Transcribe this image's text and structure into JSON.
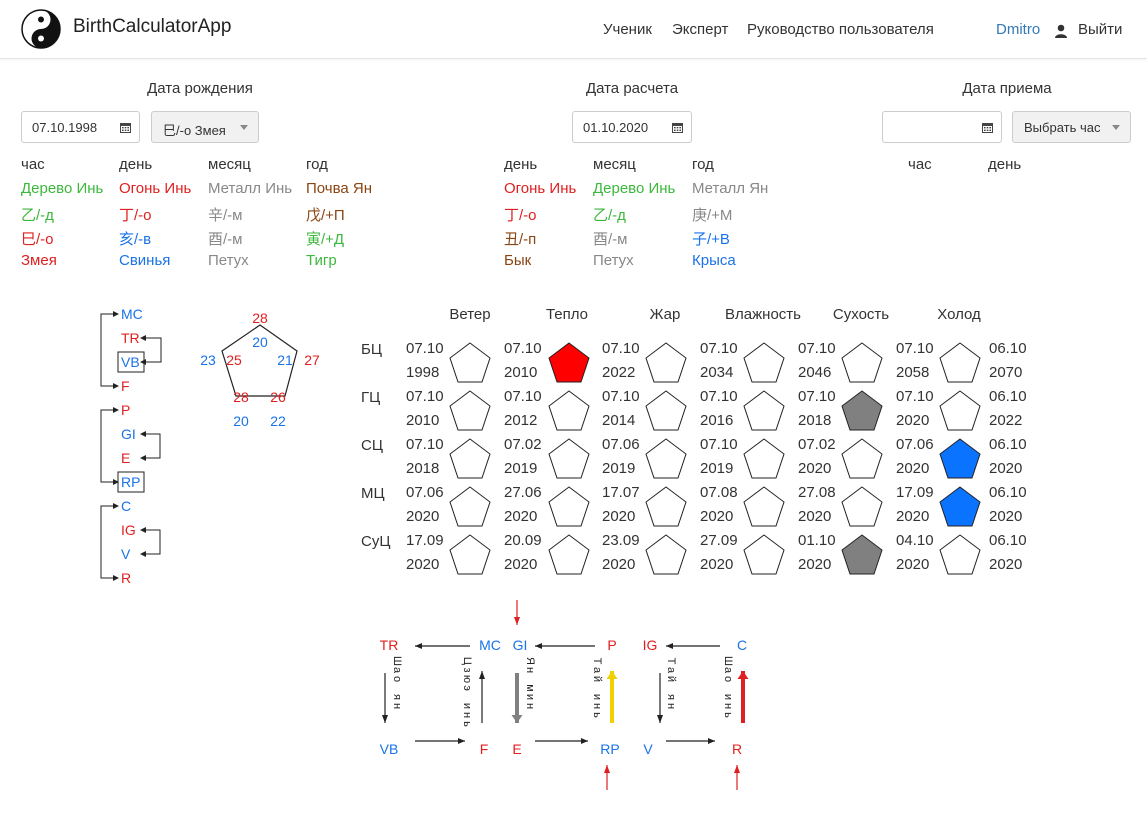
{
  "colors": {
    "red": "#e02020",
    "green": "#3cb83c",
    "blue": "#1a73e8",
    "gray": "#888888",
    "brown": "#8b4513",
    "link": "#337ab7",
    "pentRed": "#ff0000",
    "pentGray": "#808080",
    "pentBlue": "#0a73ff",
    "arrowYellow": "#f0d000"
  },
  "navbar": {
    "brand": "BirthCalculatorApp",
    "logo_icon": "yin-yang-icon",
    "links": [
      "Ученик",
      "Эксперт",
      "Руководство пользователя"
    ],
    "user": "Dmitro",
    "user_icon": "user-icon",
    "logout": "Выйти"
  },
  "birth": {
    "title": "Дата рождения",
    "date": "07.10.1998",
    "hour_select": "巳/-о Змея",
    "calendar_icon": "calendar-icon"
  },
  "calc": {
    "title": "Дата расчета",
    "date": "01.10.2020"
  },
  "reception": {
    "title": "Дата приема",
    "date": "",
    "hour_select": "Выбрать час"
  },
  "birth_pillars": [
    {
      "header": "час",
      "element": "Дерево Инь",
      "element_color": "green",
      "stem": "乙/-д",
      "stem_color": "green",
      "branch": "巳/-о",
      "branch_color": "red",
      "animal": "Змея",
      "animal_color": "red"
    },
    {
      "header": "день",
      "element": "Огонь Инь",
      "element_color": "red",
      "stem": "丁/-о",
      "stem_color": "red",
      "branch": "亥/-в",
      "branch_color": "blue",
      "animal": "Свинья",
      "animal_color": "blue"
    },
    {
      "header": "месяц",
      "element": "Металл Инь",
      "element_color": "gray",
      "stem": "辛/-м",
      "stem_color": "gray",
      "branch": "酉/-м",
      "branch_color": "gray",
      "animal": "Петух",
      "animal_color": "gray"
    },
    {
      "header": "год",
      "element": "Почва Ян",
      "element_color": "brown",
      "stem": "戊/+П",
      "stem_color": "brown",
      "branch": "寅/+Д",
      "branch_color": "green",
      "animal": "Тигр",
      "animal_color": "green"
    }
  ],
  "calc_pillars": [
    {
      "header": "день",
      "element": "Огонь Инь",
      "element_color": "red",
      "stem": "丁/-о",
      "stem_color": "red",
      "branch": "丑/-п",
      "branch_color": "brown",
      "animal": "Бык",
      "animal_color": "brown"
    },
    {
      "header": "месяц",
      "element": "Дерево Инь",
      "element_color": "green",
      "stem": "乙/-д",
      "stem_color": "green",
      "branch": "酉/-м",
      "branch_color": "gray",
      "animal": "Петух",
      "animal_color": "gray"
    },
    {
      "header": "год",
      "element": "Металл Ян",
      "element_color": "gray",
      "stem": "庚/+М",
      "stem_color": "gray",
      "branch": "子/+В",
      "branch_color": "blue",
      "animal": "Крыса",
      "animal_color": "blue"
    }
  ],
  "reception_headers": [
    "час",
    "день"
  ],
  "meridians": {
    "groups": [
      [
        {
          "label": "MC",
          "color": "blue"
        },
        {
          "label": "TR",
          "color": "red"
        },
        {
          "label": "VB",
          "color": "blue",
          "boxed": true
        },
        {
          "label": "F",
          "color": "red"
        }
      ],
      [
        {
          "label": "P",
          "color": "red"
        },
        {
          "label": "GI",
          "color": "blue"
        },
        {
          "label": "E",
          "color": "red"
        },
        {
          "label": "RP",
          "color": "blue",
          "boxed": true
        }
      ],
      [
        {
          "label": "C",
          "color": "blue"
        },
        {
          "label": "IG",
          "color": "red"
        },
        {
          "label": "V",
          "color": "blue"
        },
        {
          "label": "R",
          "color": "red"
        }
      ]
    ]
  },
  "pentagon_numbers": [
    {
      "v": "28",
      "color": "red"
    },
    {
      "v": "20",
      "color": "blue"
    },
    {
      "v": "23",
      "color": "blue"
    },
    {
      "v": "25",
      "color": "red"
    },
    {
      "v": "21",
      "color": "blue"
    },
    {
      "v": "27",
      "color": "red"
    },
    {
      "v": "28",
      "color": "red"
    },
    {
      "v": "26",
      "color": "red"
    },
    {
      "v": "20",
      "color": "blue"
    },
    {
      "v": "22",
      "color": "blue"
    }
  ],
  "climate": {
    "columns": [
      "Ветер",
      "Тепло",
      "Жар",
      "Влажность",
      "Сухость",
      "Холод"
    ],
    "rows": [
      {
        "label": "БЦ",
        "dates": [
          [
            "07.10",
            "1998"
          ],
          [
            "07.10",
            "2010"
          ],
          [
            "07.10",
            "2022"
          ],
          [
            "07.10",
            "2034"
          ],
          [
            "07.10",
            "2046"
          ],
          [
            "07.10",
            "2058"
          ],
          [
            "06.10",
            "2070"
          ]
        ],
        "fills": [
          "white",
          "red",
          "white",
          "white",
          "white",
          "white"
        ]
      },
      {
        "label": "ГЦ",
        "dates": [
          [
            "07.10",
            "2010"
          ],
          [
            "07.10",
            "2012"
          ],
          [
            "07.10",
            "2014"
          ],
          [
            "07.10",
            "2016"
          ],
          [
            "07.10",
            "2018"
          ],
          [
            "07.10",
            "2020"
          ],
          [
            "06.10",
            "2022"
          ]
        ],
        "fills": [
          "white",
          "white",
          "white",
          "white",
          "gray",
          "white"
        ]
      },
      {
        "label": "СЦ",
        "dates": [
          [
            "07.10",
            "2018"
          ],
          [
            "07.02",
            "2019"
          ],
          [
            "07.06",
            "2019"
          ],
          [
            "07.10",
            "2019"
          ],
          [
            "07.02",
            "2020"
          ],
          [
            "07.06",
            "2020"
          ],
          [
            "06.10",
            "2020"
          ]
        ],
        "fills": [
          "white",
          "white",
          "white",
          "white",
          "white",
          "blue"
        ]
      },
      {
        "label": "МЦ",
        "dates": [
          [
            "07.06",
            "2020"
          ],
          [
            "27.06",
            "2020"
          ],
          [
            "17.07",
            "2020"
          ],
          [
            "07.08",
            "2020"
          ],
          [
            "27.08",
            "2020"
          ],
          [
            "17.09",
            "2020"
          ],
          [
            "06.10",
            "2020"
          ]
        ],
        "fills": [
          "white",
          "white",
          "white",
          "white",
          "white",
          "blue"
        ]
      },
      {
        "label": "СуЦ",
        "dates": [
          [
            "17.09",
            "2020"
          ],
          [
            "20.09",
            "2020"
          ],
          [
            "23.09",
            "2020"
          ],
          [
            "27.09",
            "2020"
          ],
          [
            "01.10",
            "2020"
          ],
          [
            "04.10",
            "2020"
          ],
          [
            "06.10",
            "2020"
          ]
        ],
        "fills": [
          "white",
          "white",
          "white",
          "white",
          "gray",
          "white"
        ]
      }
    ]
  },
  "flow": {
    "top_labels": [
      {
        "t": "TR",
        "c": "red"
      },
      {
        "t": "MC",
        "c": "blue"
      },
      {
        "t": "GI",
        "c": "blue"
      },
      {
        "t": "P",
        "c": "red"
      },
      {
        "t": "IG",
        "c": "red"
      },
      {
        "t": "C",
        "c": "blue"
      }
    ],
    "bottom_labels": [
      {
        "t": "VB",
        "c": "blue"
      },
      {
        "t": "F",
        "c": "red"
      },
      {
        "t": "E",
        "c": "red"
      },
      {
        "t": "RP",
        "c": "blue"
      },
      {
        "t": "V",
        "c": "blue"
      },
      {
        "t": "R",
        "c": "red"
      }
    ],
    "vertical_texts": [
      {
        "lines": [
          "Ш",
          "а",
          "о",
          "",
          "я",
          "н"
        ]
      },
      {
        "lines": [
          "Ц",
          "з",
          "ю",
          "э",
          "",
          "и",
          "н",
          "ь"
        ]
      },
      {
        "lines": [
          "Я",
          "н",
          "",
          "м",
          "и",
          "н"
        ]
      },
      {
        "lines": [
          "Т",
          "а",
          "й",
          "",
          "и",
          "н",
          "ь"
        ]
      },
      {
        "lines": [
          "Т",
          "а",
          "й",
          "",
          "я",
          "н"
        ]
      },
      {
        "lines": [
          "Ш",
          "а",
          "о",
          "",
          "и",
          "н",
          "ь"
        ]
      }
    ]
  }
}
